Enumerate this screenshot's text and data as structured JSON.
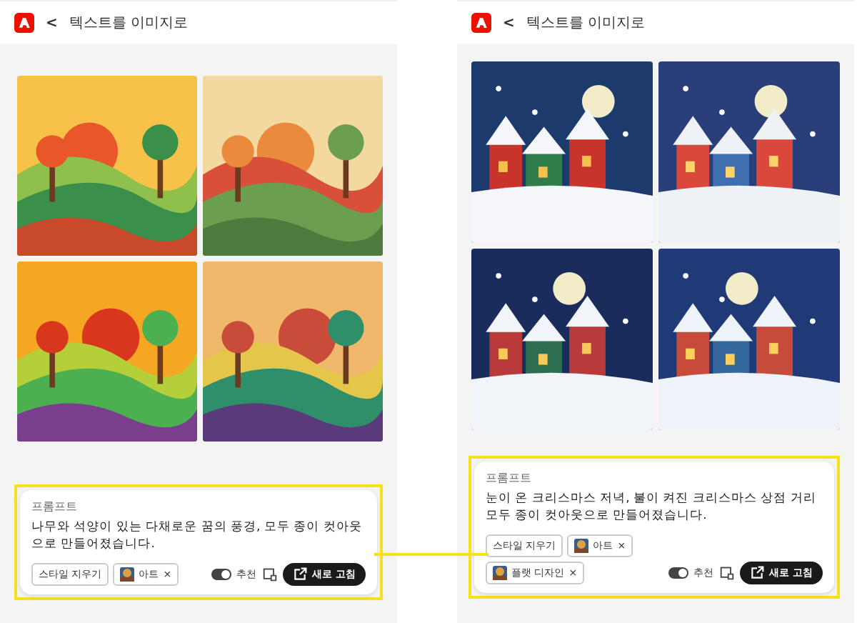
{
  "panels": [
    {
      "title": "텍스트를 이미지로",
      "back": "<",
      "prompt": {
        "label": "프롬프트",
        "text": "나무와 석양이 있는 다채로운 꿈의 풍경, 모두 종이 컷아웃으로 만들어졌습니다.",
        "chips": [
          {
            "kind": "clear",
            "label": "스타일 지우기"
          },
          {
            "kind": "style",
            "label": "아트",
            "remove": "×"
          }
        ],
        "toggle": {
          "label": "추천",
          "on": true
        },
        "button": "새로 고침"
      }
    },
    {
      "title": "텍스트를 이미지로",
      "back": "<",
      "prompt": {
        "label": "프롬프트",
        "text": "눈이 온 크리스마스 저녁, 불이 켜진 크리스마스 상점 거리 모두 종이 컷아웃으로 만들어졌습니다.",
        "chips": [
          {
            "kind": "clear",
            "label": "스타일 지우기"
          },
          {
            "kind": "style",
            "label": "아트",
            "remove": "×"
          },
          {
            "kind": "style",
            "label": "플랫 디자인",
            "remove": "×"
          }
        ],
        "toggle": {
          "label": "추천",
          "on": true
        },
        "button": "새로 고침"
      }
    }
  ]
}
